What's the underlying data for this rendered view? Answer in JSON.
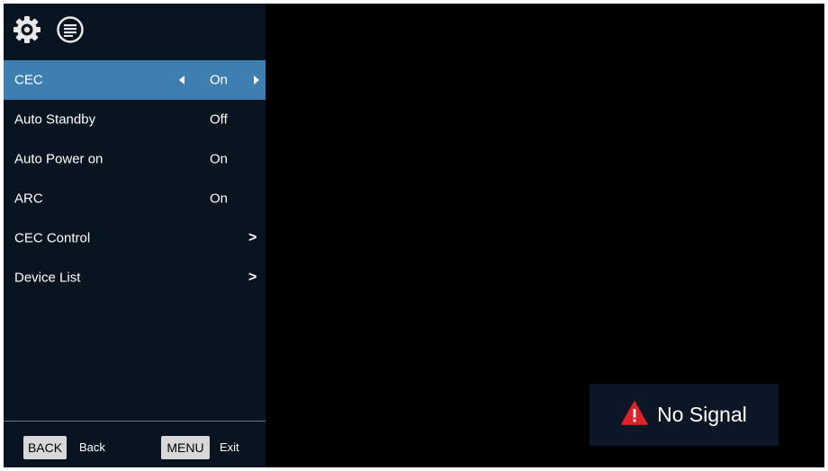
{
  "topbar": {
    "settings_icon": "gear-icon",
    "menu_icon": "list-icon"
  },
  "menu": {
    "items": [
      {
        "label": "CEC",
        "value": "On",
        "selected": true
      },
      {
        "label": "Auto Standby",
        "value": "Off"
      },
      {
        "label": "Auto Power on",
        "value": "On"
      },
      {
        "label": "ARC",
        "value": "On"
      },
      {
        "label": "CEC Control",
        "value": ""
      },
      {
        "label": "Device List",
        "value": ""
      }
    ]
  },
  "footer": {
    "back_key": "BACK",
    "back_label": "Back",
    "menu_key": "MENU",
    "menu_label": "Exit"
  },
  "toast": {
    "icon": "warning-icon",
    "text": "No Signal"
  },
  "colors": {
    "panel_bg": "#081420",
    "selected_row": "#3d7fb0",
    "warning": "#e0202a"
  }
}
